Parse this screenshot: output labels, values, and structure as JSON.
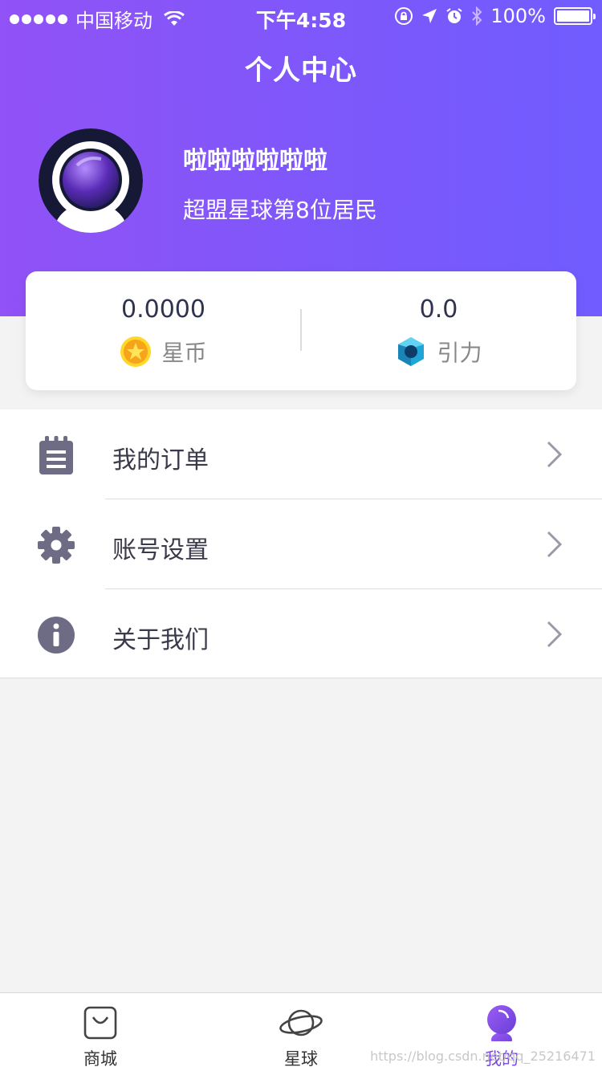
{
  "status_bar": {
    "carrier": "中国移动",
    "time": "下午4:58",
    "battery": "100%"
  },
  "header": {
    "title": "个人中心"
  },
  "profile": {
    "name": "啦啦啦啦啦啦",
    "subtitle": "超盟星球第8位居民"
  },
  "stats": {
    "left": {
      "value": "0.0000",
      "label": "星币",
      "icon": "star-coin-icon"
    },
    "right": {
      "value": "0.0",
      "label": "引力",
      "icon": "diamond-icon"
    }
  },
  "menu": [
    {
      "label": "我的订单",
      "icon": "clipboard-icon"
    },
    {
      "label": "账号设置",
      "icon": "gear-icon"
    },
    {
      "label": "关于我们",
      "icon": "info-icon"
    }
  ],
  "tabbar": {
    "tabs": [
      {
        "label": "商城",
        "icon": "shopping-bag-icon"
      },
      {
        "label": "星球",
        "icon": "planet-icon"
      },
      {
        "label": "我的",
        "icon": "astronaut-icon",
        "active": true
      }
    ]
  },
  "watermark": "https://blog.csdn.net/qq_25216471",
  "colors": {
    "header_gradient_start": "#9152f6",
    "header_gradient_end": "#705cff",
    "active_tab": "#7a45e8",
    "menu_icon": "#6d6c84"
  }
}
